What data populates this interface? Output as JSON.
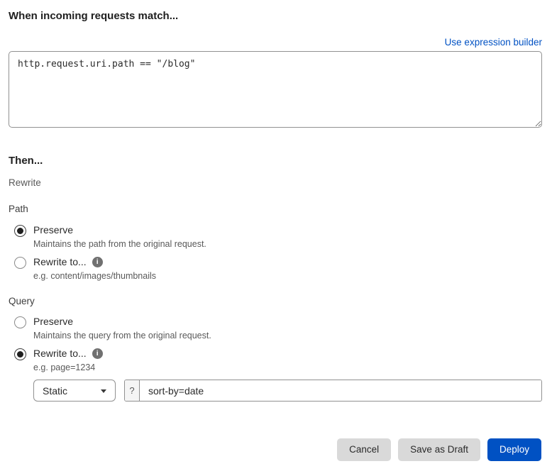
{
  "colors": {
    "accent_blue": "#0051c3",
    "text_dark": "#202020",
    "text_gray": "#595959",
    "border_gray": "#919191",
    "button_gray": "#d9d9d9"
  },
  "match_section": {
    "heading": "When incoming requests match...",
    "expression_builder_link": "Use expression builder",
    "expression_value": "http.request.uri.path == \"/blog\""
  },
  "then_section": {
    "heading": "Then...",
    "subheading": "Rewrite",
    "path_group": {
      "label": "Path",
      "options": [
        {
          "label": "Preserve",
          "description": "Maintains the path from the original request.",
          "selected": true
        },
        {
          "label": "Rewrite to...",
          "description": "e.g. content/images/thumbnails",
          "selected": false,
          "info_icon": "i"
        }
      ]
    },
    "query_group": {
      "label": "Query",
      "options": [
        {
          "label": "Preserve",
          "description": "Maintains the query from the original request.",
          "selected": false
        },
        {
          "label": "Rewrite to...",
          "description": "e.g. page=1234",
          "selected": true,
          "info_icon": "i"
        }
      ],
      "rewrite_controls": {
        "type_select_value": "Static",
        "prefix": "?",
        "value_input": "sort-by=date"
      }
    }
  },
  "footer": {
    "cancel_label": "Cancel",
    "save_draft_label": "Save as Draft",
    "deploy_label": "Deploy"
  }
}
